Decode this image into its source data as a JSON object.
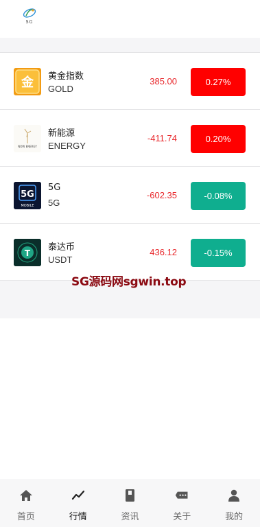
{
  "header": {
    "logo_text": "SG"
  },
  "items": [
    {
      "name": "黄金指数",
      "code": "GOLD",
      "price": "385.00",
      "change": "0.27%",
      "change_color": "#ff0000",
      "icon": "gold-coin-icon"
    },
    {
      "name": "新能源",
      "code": "ENERGY",
      "price": "-411.74",
      "change": "0.20%",
      "change_color": "#ff0000",
      "icon": "new-energy-icon"
    },
    {
      "name": "5G",
      "code": "5G",
      "price": "-602.35",
      "change": "-0.08%",
      "change_color": "#0fae8f",
      "icon": "5g-mobile-icon"
    },
    {
      "name": "泰达币",
      "code": "USDT",
      "price": "436.12",
      "change": "-0.15%",
      "change_color": "#0fae8f",
      "icon": "tether-icon"
    }
  ],
  "thumb_text": {
    "gold": "金",
    "energy": "NOW ENERGY",
    "fiveg_big": "5G",
    "fiveg_small": "MOBILE",
    "tether": "T"
  },
  "watermark": "SG源码网sgwin.top",
  "tabbar": [
    {
      "label": "首页",
      "icon": "home-icon",
      "active": false
    },
    {
      "label": "行情",
      "icon": "trend-icon",
      "active": true
    },
    {
      "label": "资讯",
      "icon": "book-icon",
      "active": false
    },
    {
      "label": "关于",
      "icon": "message-icon",
      "active": false
    },
    {
      "label": "我的",
      "icon": "user-icon",
      "active": false
    }
  ]
}
